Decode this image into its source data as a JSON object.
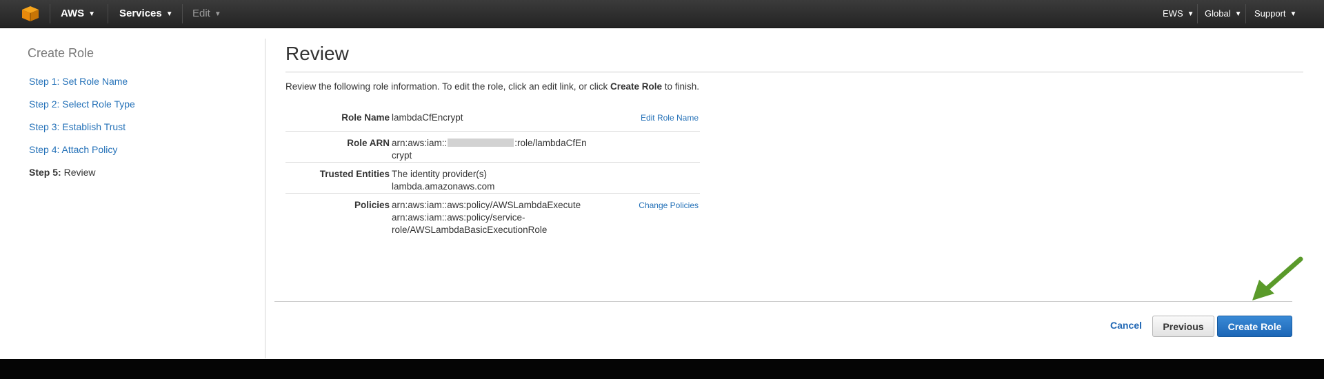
{
  "topnav": {
    "logo_icon": "aws-cube-icon",
    "aws_label": "AWS",
    "services_label": "Services",
    "edit_label": "Edit",
    "account_label": "EWS",
    "region_label": "Global",
    "support_label": "Support"
  },
  "sidebar": {
    "title": "Create Role",
    "steps": [
      {
        "label": "Step 1: Set Role Name"
      },
      {
        "label": "Step 2: Select Role Type"
      },
      {
        "label": "Step 3: Establish Trust"
      },
      {
        "label": "Step 4: Attach Policy"
      }
    ],
    "current_step_prefix": "Step 5:",
    "current_step_label": "Review"
  },
  "main": {
    "title": "Review",
    "intro_prefix": "Review the following role information. To edit the role, click an edit link, or click ",
    "intro_bold": "Create Role",
    "intro_suffix": " to finish.",
    "role_name_label": "Role Name",
    "role_name_value": "lambdaCfEncrypt",
    "edit_role_name_link": "Edit Role Name",
    "role_arn_label": "Role ARN",
    "role_arn_prefix": "arn:aws:iam::",
    "role_arn_suffix": ":role/lambdaCfEn",
    "role_arn_wrap": "crypt",
    "trusted_label": "Trusted Entities",
    "trusted_line1": "The identity provider(s)",
    "trusted_line2": "lambda.amazonaws.com",
    "policies_label": "Policies",
    "policy_line1": "arn:aws:iam::aws:policy/AWSLambdaExecute",
    "policy_line2": "arn:aws:iam::aws:policy/service-",
    "policy_line3": "role/AWSLambdaBasicExecutionRole",
    "change_policies_link": "Change Policies"
  },
  "footer": {
    "cancel_label": "Cancel",
    "previous_label": "Previous",
    "create_label": "Create Role"
  },
  "colors": {
    "link": "#2471b8",
    "primary_button": "#1c66b6",
    "annotation_arrow": "#5a9a2a",
    "nav_bg": "#2b2b2b"
  }
}
